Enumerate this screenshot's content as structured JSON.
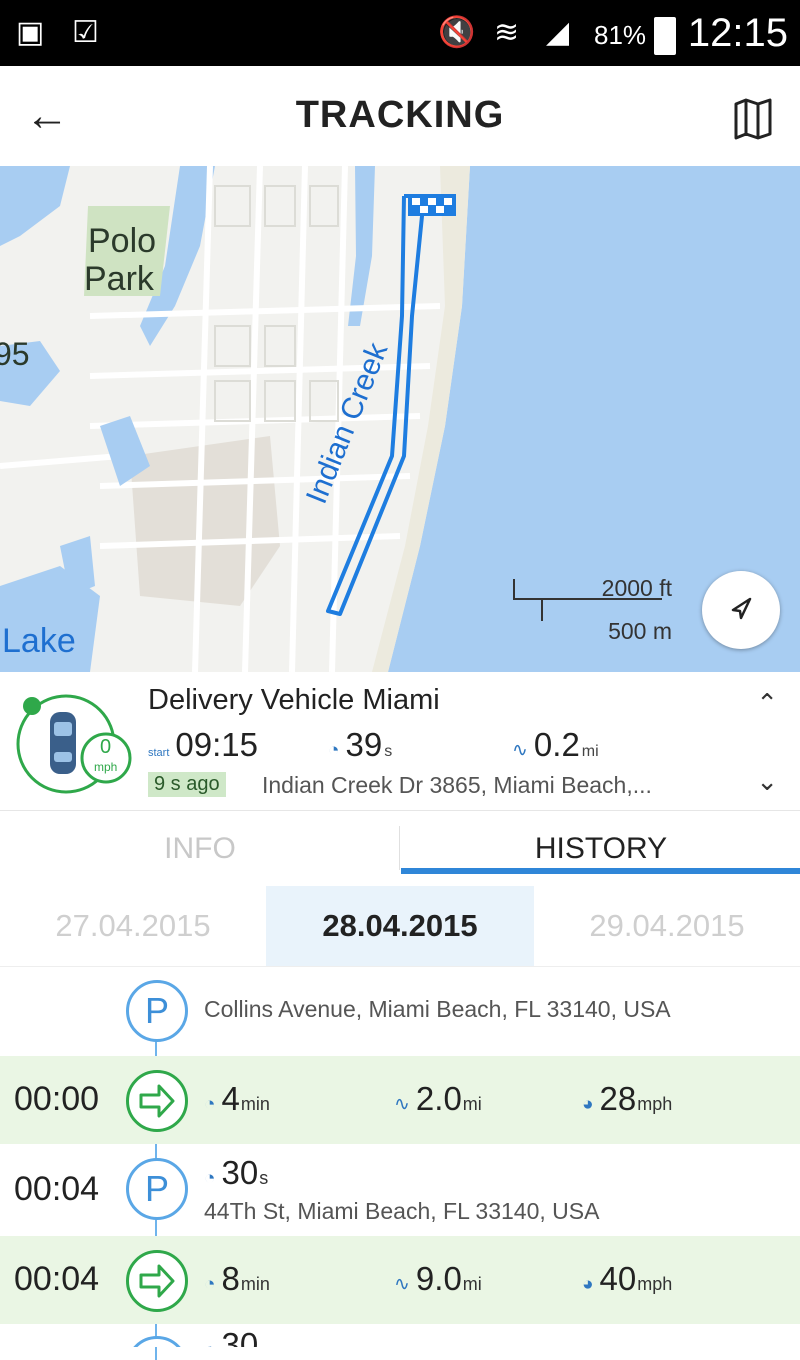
{
  "status_bar": {
    "battery_pct": "81%",
    "time": "12:15",
    "icons": [
      "gallery-icon",
      "clipboard-check-icon",
      "mute-icon",
      "wifi-icon",
      "signal-icon",
      "battery-icon"
    ]
  },
  "header": {
    "title": "TRACKING",
    "back_icon": "arrow-left-icon",
    "map_icon": "map-icon"
  },
  "map": {
    "labels": {
      "polo": "Polo",
      "park": "Park",
      "route_label": "Indian Creek",
      "lake": "Lake",
      "partial": "95"
    },
    "scale_top": "2000 ft",
    "scale_bottom": "500 m",
    "colors": {
      "water": "#a8cdf2",
      "land": "#f2f2ef",
      "route": "#1e7de0",
      "park": "#cfe3c2"
    }
  },
  "vehicle": {
    "name": "Delivery Vehicle Miami",
    "speed_value": "0",
    "speed_unit": "mph",
    "start_label": "start",
    "start_time": "09:15",
    "duration_value": "39",
    "duration_unit": "s",
    "distance_value": "0.2",
    "distance_unit": "mi",
    "ago": "9 s ago",
    "address": "Indian Creek Dr 3865, Miami Beach,..."
  },
  "tabs": {
    "info": "INFO",
    "history": "HISTORY"
  },
  "dates": {
    "prev": "27.04.2015",
    "current": "28.04.2015",
    "next": "29.04.2015"
  },
  "timeline": {
    "items": [
      {
        "type": "parking",
        "time": "",
        "address": "Collins Avenue, Miami Beach, FL 33140, USA"
      },
      {
        "type": "drive",
        "time": "00:00",
        "duration_value": "4",
        "duration_unit": "min",
        "distance_value": "2.0",
        "distance_unit": "mi",
        "speed_value": "28",
        "speed_unit": "mph"
      },
      {
        "type": "parking",
        "time": "00:04",
        "duration_value": "30",
        "duration_unit": "s",
        "address": "44Th St, Miami Beach, FL 33140, USA"
      },
      {
        "type": "drive",
        "time": "00:04",
        "duration_value": "8",
        "duration_unit": "min",
        "distance_value": "9.0",
        "distance_unit": "mi",
        "speed_value": "40",
        "speed_unit": "mph"
      },
      {
        "type": "parking",
        "time": "",
        "duration_value": "30",
        "duration_unit": ""
      }
    ]
  }
}
